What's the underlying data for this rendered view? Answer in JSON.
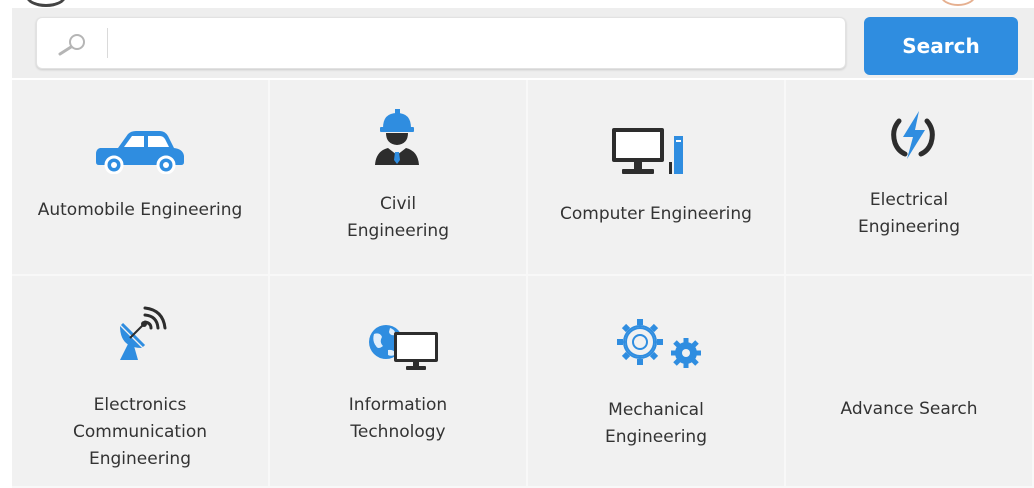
{
  "search": {
    "placeholder": "",
    "button_label": "Search"
  },
  "categories": [
    {
      "icon": "car-icon",
      "lines": [
        "Automobile Engineering"
      ]
    },
    {
      "icon": "engineer-helmet-icon",
      "lines": [
        "Civil",
        "Engineering"
      ]
    },
    {
      "icon": "computer-monitor-icon",
      "lines": [
        "Computer Engineering"
      ]
    },
    {
      "icon": "lightning-bolt-icon",
      "lines": [
        "Electrical",
        "Engineering"
      ]
    },
    {
      "icon": "satellite-dish-icon",
      "lines": [
        "Electronics",
        "Communication",
        "Engineering"
      ]
    },
    {
      "icon": "globe-monitor-icon",
      "lines": [
        "Information",
        "Technology"
      ]
    },
    {
      "icon": "gears-icon",
      "lines": [
        "Mechanical",
        "Engineering"
      ]
    },
    {
      "icon": "",
      "lines": [
        "Advance Search"
      ]
    }
  ],
  "colors": {
    "accent": "#2f8de0",
    "tile_bg": "#f1f1f1",
    "band_bg": "#eeeeee",
    "text": "#333333"
  }
}
